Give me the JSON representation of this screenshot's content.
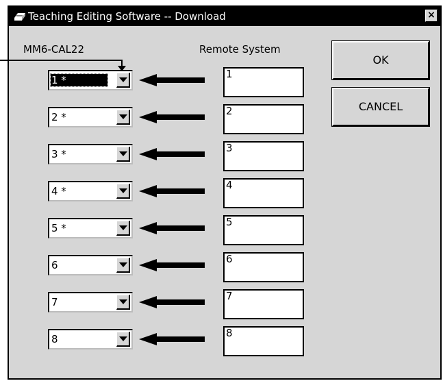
{
  "window": {
    "title": "Teaching Editing Software -- Download",
    "close_glyph": "×",
    "app_icon": "printer-icon"
  },
  "columns": {
    "left_header": "MM6-CAL22",
    "right_header": "Remote System"
  },
  "rows": [
    {
      "combo_value": "1 *",
      "remote_value": "1",
      "selected": true
    },
    {
      "combo_value": "2 *",
      "remote_value": "2",
      "selected": false
    },
    {
      "combo_value": "3 *",
      "remote_value": "3",
      "selected": false
    },
    {
      "combo_value": "4 *",
      "remote_value": "4",
      "selected": false
    },
    {
      "combo_value": "5 *",
      "remote_value": "5",
      "selected": false
    },
    {
      "combo_value": "6",
      "remote_value": "6",
      "selected": false
    },
    {
      "combo_value": "7",
      "remote_value": "7",
      "selected": false
    },
    {
      "combo_value": "8",
      "remote_value": "8",
      "selected": false
    }
  ],
  "buttons": {
    "ok_label": "OK",
    "cancel_label": "CANCEL"
  },
  "colors": {
    "dialog_face": "#d6d6d6",
    "titlebar": "#000000",
    "title_text": "#ffffff"
  }
}
